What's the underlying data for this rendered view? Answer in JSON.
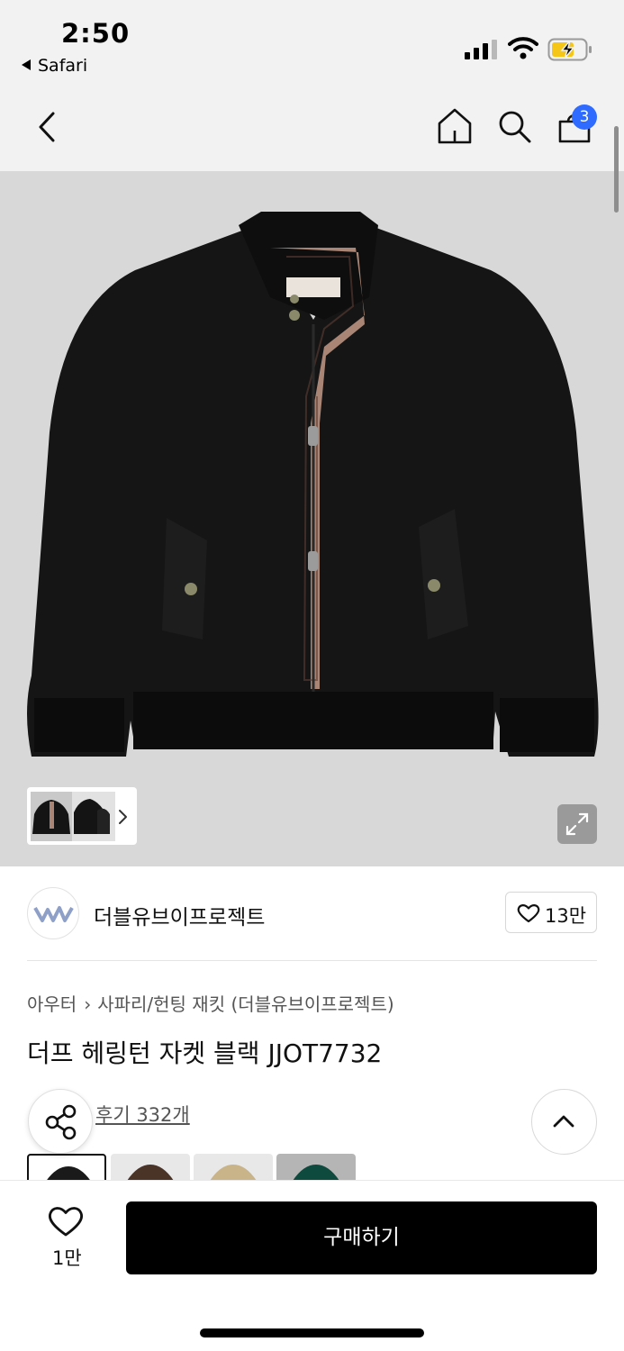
{
  "status_bar": {
    "time": "2:50",
    "back_app": "Safari",
    "icons": [
      "cellular-signal-icon",
      "wifi-icon",
      "battery-charging-icon"
    ]
  },
  "nav": {
    "icons": [
      "back-chevron-icon",
      "home-icon",
      "search-icon",
      "cart-icon"
    ],
    "cart_count": "3"
  },
  "product_image": {
    "alt": "black harrington jacket with check lining",
    "thumbnails": [
      "black-jacket-front",
      "black-jacket-side"
    ],
    "thumb_arrow_icon": "chevron-right-icon",
    "expand_icon": "expand-icon"
  },
  "brand": {
    "logo_text": "WV",
    "name": "더블유브이프로젝트",
    "like_count": "13만",
    "like_icon": "heart-outline-icon"
  },
  "breadcrumb": {
    "category": "아우터",
    "subcategory": "사파리/헌팅 재킷 (더블유브이프로젝트)"
  },
  "product": {
    "title": "더프 헤링턴 자켓 블랙 JJOT7732",
    "review_link": "후기 332개"
  },
  "color_swatches": [
    "black",
    "brown",
    "beige",
    "green"
  ],
  "colors": {
    "accent_badge": "#2f6bff",
    "buy_button": "#000000",
    "image_background": "#d8d8d8"
  },
  "bottom_bar": {
    "wish_count": "1만",
    "buy_label": "구매하기"
  }
}
